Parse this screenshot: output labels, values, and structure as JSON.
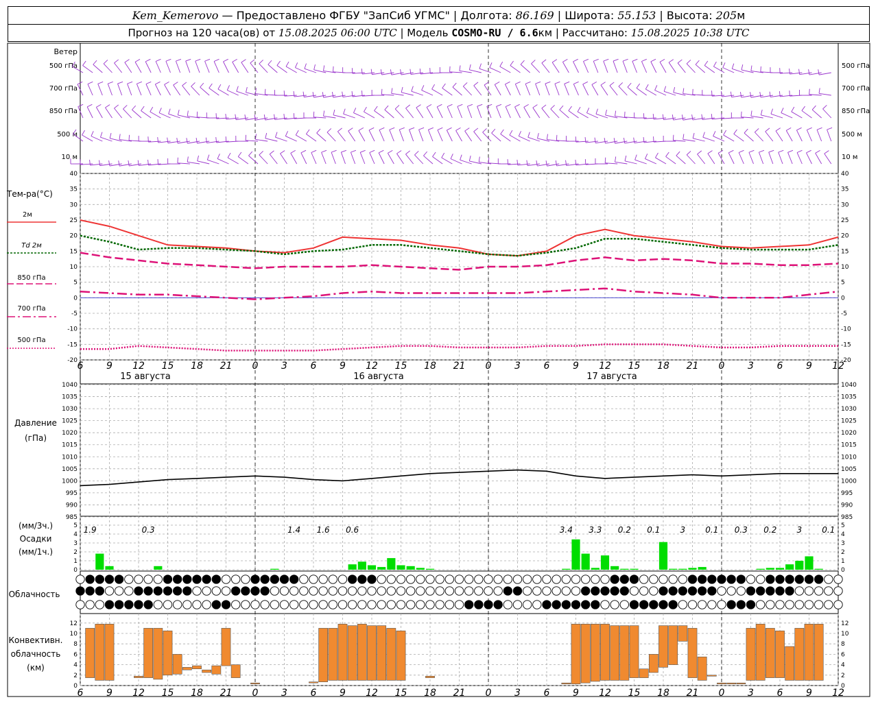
{
  "header": {
    "station": "Kem_Kemerovo",
    "provider": " — Предоставлено ФГБУ \"ЗапСиб УГМС\" | Долгота: ",
    "lon": "86.169",
    "lat_label": " | Широта: ",
    "lat": "55.153",
    "alt_label": " | Высота: ",
    "alt": "205",
    "alt_unit": "м",
    "forecast_label": "Прогноз на 120 часа(ов) от ",
    "forecast_time": "15.08.2025 06:00 UTC",
    "model_label": " | Модель ",
    "model": "COSMO-RU / 6.6",
    "model_unit": "км",
    "calc_label": " | Рассчитано: ",
    "calc_time": "15.08.2025 10:38 UTC"
  },
  "wind": {
    "title": "Ветер",
    "levels": [
      "500 гПа",
      "700 гПа",
      "850 гПа",
      "500 м",
      "10  м"
    ],
    "color": "#9933cc"
  },
  "time_axis": {
    "ticks": [
      "6",
      "9",
      "12",
      "15",
      "18",
      "21",
      "0",
      "3",
      "6",
      "9",
      "12",
      "15",
      "18",
      "21",
      "0",
      "3",
      "6",
      "9",
      "12",
      "15",
      "18",
      "21",
      "0",
      "3",
      "6",
      "9",
      "12"
    ],
    "dates": [
      "15 августа",
      "16 августа",
      "17 августа"
    ]
  },
  "temperature": {
    "title": "Тем-ра(°C)",
    "legend": [
      {
        "label": "2м",
        "color": "#ee3333"
      },
      {
        "label": "Td  2м",
        "color": "#006600"
      },
      {
        "label": "850 гПа",
        "color": "#dd1177"
      },
      {
        "label": "700 гПа",
        "color": "#dd1177"
      },
      {
        "label": "500 гПа",
        "color": "#dd1177"
      }
    ],
    "yticks": [
      "40",
      "35",
      "30",
      "25",
      "20",
      "15",
      "10",
      "5",
      "0",
      "-5",
      "-10",
      "-15",
      "-20"
    ]
  },
  "pressure": {
    "title1": "Давление",
    "title2": "(гПа)",
    "yticks": [
      "1040",
      "1035",
      "1030",
      "1025",
      "1020",
      "1015",
      "1010",
      "1005",
      "1000",
      "995",
      "990",
      "985"
    ]
  },
  "precip": {
    "label1": "(мм/3ч.)",
    "label2": "Осадки",
    "label3": "(мм/1ч.)",
    "yticks": [
      "5",
      "4",
      "3",
      "2",
      "1",
      "0"
    ],
    "totals": [
      "1.9",
      "0.3",
      "1.4",
      "1.6",
      "0.6",
      "3.4",
      "3.3",
      "0.2",
      "0.1",
      "3",
      "0.1",
      "0.3",
      "0.2",
      "3",
      "0.1"
    ]
  },
  "clouds": {
    "title": "Облачность"
  },
  "convective": {
    "title1": "Конвективн.",
    "title2": "облачность",
    "title3": "(км)",
    "yticks": [
      "12",
      "10",
      "8",
      "6",
      "4",
      "2",
      "0"
    ]
  },
  "chart_data": [
    {
      "type": "line",
      "title": "Тем-ра(°C)",
      "x": [
        0,
        3,
        6,
        9,
        12,
        15,
        18,
        21,
        24,
        27,
        30,
        33,
        36,
        39,
        42,
        45,
        48,
        51,
        54,
        57,
        60,
        63,
        66,
        69,
        72,
        75,
        78
      ],
      "series": [
        {
          "name": "2м",
          "values": [
            25,
            23,
            20,
            17,
            16.5,
            16,
            15,
            14.5,
            16,
            19.5,
            19,
            18.5,
            17,
            16,
            14,
            13.5,
            15,
            20,
            22,
            20,
            19,
            18,
            16.5,
            16,
            16.5,
            17,
            19.5
          ]
        },
        {
          "name": "Td  2м",
          "values": [
            20,
            18,
            15.5,
            16,
            16,
            15.5,
            15,
            14,
            15,
            15.5,
            17,
            17,
            16,
            15,
            14,
            13.5,
            14.5,
            16,
            19,
            19,
            18,
            17,
            16,
            15.5,
            15.5,
            15.5,
            17
          ]
        },
        {
          "name": "850 гПа",
          "values": [
            14.5,
            13,
            12,
            11,
            10.5,
            10,
            9.5,
            10,
            10,
            10,
            10.5,
            10,
            9.5,
            9,
            10,
            10,
            10.5,
            12,
            13,
            12,
            12.5,
            12,
            11,
            11,
            10.5,
            10.5,
            11
          ]
        },
        {
          "name": "700 гПа",
          "values": [
            2,
            1.5,
            1,
            1,
            0.5,
            0,
            -0.5,
            0,
            0.5,
            1.5,
            2,
            1.5,
            1.5,
            1.5,
            1.5,
            1.5,
            2,
            2.5,
            3,
            2,
            1.5,
            1,
            0,
            0,
            0,
            1,
            2
          ]
        },
        {
          "name": "500 гПа",
          "values": [
            -16.5,
            -16.5,
            -15.5,
            -16,
            -16.5,
            -17,
            -17,
            -17,
            -17,
            -16.5,
            -16,
            -15.5,
            -15.5,
            -16,
            -16,
            -16,
            -15.5,
            -15.5,
            -15,
            -15,
            -15,
            -15.5,
            -16,
            -16,
            -15.5,
            -15.5,
            -15.5
          ]
        }
      ],
      "ylim": [
        -20,
        40
      ],
      "grid": true
    },
    {
      "type": "line",
      "title": "Давление",
      "x": [
        0,
        3,
        6,
        9,
        12,
        15,
        18,
        21,
        24,
        27,
        30,
        33,
        36,
        39,
        42,
        45,
        48,
        51,
        54,
        57,
        60,
        63,
        66,
        69,
        72,
        75,
        78
      ],
      "series": [
        {
          "name": "Давление",
          "values": [
            998,
            998.5,
            999.5,
            1000.5,
            1001,
            1001.5,
            1002,
            1001.5,
            1000.5,
            1000,
            1001,
            1002,
            1003,
            1003.5,
            1004,
            1004.5,
            1004,
            1002,
            1001,
            1001.5,
            1002,
            1002.5,
            1002,
            1002.5,
            1003,
            1003,
            1003
          ]
        }
      ],
      "ylim": [
        985,
        1040
      ],
      "grid": true
    },
    {
      "type": "bar",
      "title": "Осадки",
      "x": [
        2,
        3,
        8,
        20,
        28,
        29,
        30,
        31,
        32,
        33,
        34,
        35,
        36,
        50,
        51,
        52,
        53,
        54,
        55,
        56,
        57,
        60,
        61,
        62,
        63,
        64,
        70,
        71,
        72,
        73,
        74,
        75,
        76
      ],
      "values": [
        1.8,
        0.4,
        0.4,
        0.1,
        0.6,
        0.9,
        0.5,
        0.3,
        1.3,
        0.5,
        0.4,
        0.2,
        0.1,
        0.1,
        3.4,
        1.8,
        0.2,
        1.6,
        0.4,
        0.1,
        0.1,
        3.1,
        0.1,
        0.1,
        0.2,
        0.3,
        0.1,
        0.2,
        0.2,
        0.6,
        1.0,
        1.5,
        0.1
      ],
      "ylim": [
        0,
        5
      ]
    },
    {
      "type": "bar",
      "title": "Конвективн. облачность",
      "x": [
        1,
        2,
        3,
        6,
        7,
        8,
        9,
        10,
        11,
        12,
        13,
        14,
        15,
        16,
        18,
        24,
        25,
        26,
        27,
        28,
        29,
        30,
        31,
        32,
        33,
        36,
        50,
        51,
        52,
        53,
        54,
        55,
        56,
        57,
        58,
        59,
        60,
        61,
        62,
        63,
        64,
        65,
        66,
        67,
        68,
        69,
        70,
        71,
        72,
        73,
        74,
        75,
        76
      ],
      "base": [
        1.5,
        1,
        1,
        1.5,
        1.5,
        1.2,
        2,
        2.2,
        3,
        3.2,
        2.5,
        2.2,
        3.8,
        1.5,
        1.5,
        0.5,
        0.7,
        1,
        1,
        1,
        1,
        1,
        1,
        1,
        1,
        1.5,
        0.3,
        0.3,
        0.5,
        0.8,
        1,
        1,
        1,
        1.5,
        1.5,
        2.5,
        3.5,
        4,
        8.5,
        1.5,
        1,
        3.5,
        0.3,
        0.3,
        0.5,
        1,
        1,
        1.5,
        1.5,
        1,
        1,
        1,
        1
      ],
      "top": [
        11,
        11.8,
        11.8,
        1.8,
        11,
        11,
        10.5,
        6,
        3.5,
        3.8,
        3,
        3.8,
        11,
        4,
        0.5,
        0.7,
        11,
        11,
        11.8,
        11.5,
        11.8,
        11.5,
        11.5,
        11,
        10.5,
        1.8,
        0.5,
        11.8,
        11.8,
        11.8,
        11.8,
        11.5,
        11.5,
        11.5,
        3.2,
        6,
        11.5,
        11.5,
        11.5,
        11,
        5.5,
        2,
        0.5,
        0.5,
        0.5,
        11,
        11.8,
        11,
        10.5,
        7.5,
        11,
        11.8,
        11.8
      ],
      "ylim": [
        0,
        12
      ]
    }
  ]
}
